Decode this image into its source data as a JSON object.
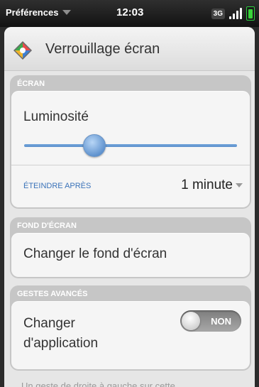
{
  "status_bar": {
    "app_menu": "Préférences",
    "time": "12:03",
    "network": "3G"
  },
  "header": {
    "title": "Verrouillage écran"
  },
  "groups": {
    "screen": {
      "label": "ÉCRAN",
      "brightness_label": "Luminosité",
      "brightness_level": 0.33,
      "turn_off_label": "ÉTEINDRE APRÈS",
      "turn_off_value": "1 minute"
    },
    "wallpaper": {
      "label": "FOND D'ÉCRAN",
      "change_label": "Changer le fond d'écran"
    },
    "gestures": {
      "label": "GESTES AVANCÉS",
      "switch_app_label": "Changer d'application",
      "toggle_state": "NON"
    }
  },
  "footer": {
    "text": "Un geste de droite à gauche sur cette"
  },
  "colors": {
    "accent": "#3b73b9",
    "slider": "#5f92cc",
    "group_header": "#c6c6c6"
  }
}
